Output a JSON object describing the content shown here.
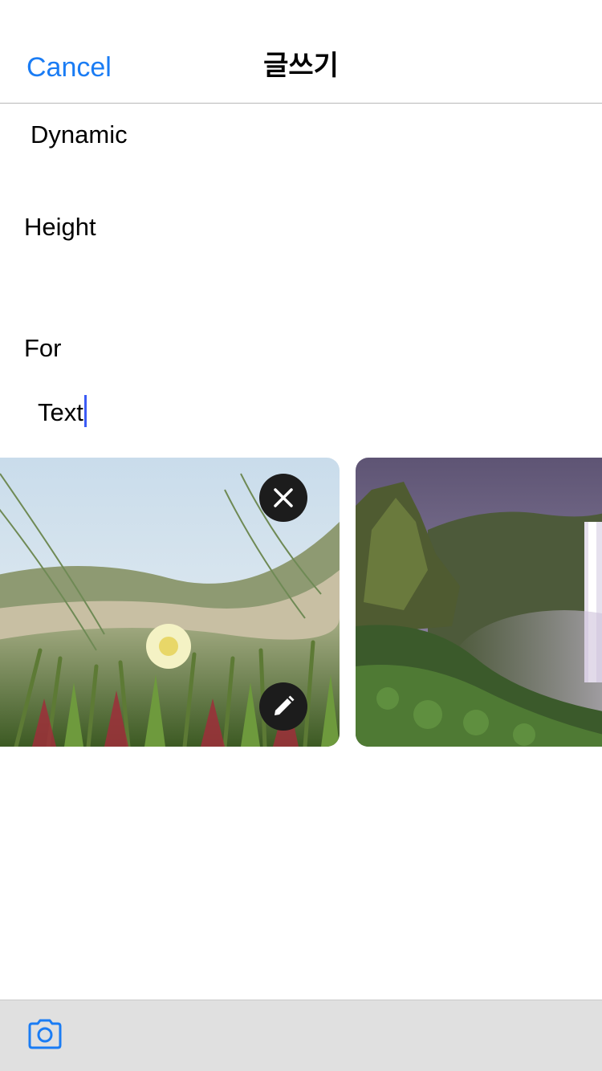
{
  "nav": {
    "cancel_label": "Cancel",
    "title": "글쓰기"
  },
  "editor": {
    "lines": [
      "Dynamic",
      "Height",
      "For",
      "Text"
    ]
  },
  "gallery": {
    "photos": [
      {
        "name": "flower-photo",
        "remove_icon": "close-icon",
        "edit_icon": "pencil-icon"
      },
      {
        "name": "waterfall-photo"
      }
    ]
  },
  "toolbar": {
    "icon": "camera-icon"
  },
  "colors": {
    "accent": "#1a7cf4",
    "caret": "#3b5bf5",
    "toolbar_bg": "#e0e0e0",
    "button_bg": "#1c1c1c"
  }
}
